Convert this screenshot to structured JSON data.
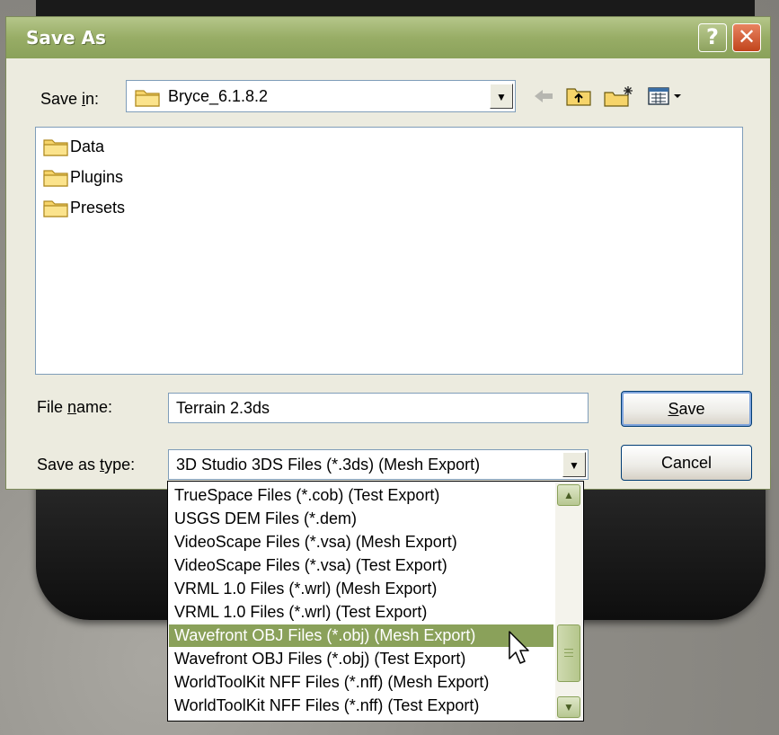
{
  "dialog": {
    "title": "Save As",
    "help_glyph": "?",
    "close_glyph": "✕"
  },
  "save_in": {
    "label_prefix": "Save ",
    "label_accel": "i",
    "label_suffix": "n:",
    "folder": "Bryce_6.1.8.2",
    "folder_icon": "folder-icon"
  },
  "toolbar": {
    "icons": [
      "back-icon",
      "up-folder-icon",
      "new-folder-icon",
      "view-menu-icon"
    ]
  },
  "files": [
    {
      "name": "Data",
      "icon": "folder-icon"
    },
    {
      "name": "Plugins",
      "icon": "folder-icon"
    },
    {
      "name": "Presets",
      "icon": "folder-icon"
    }
  ],
  "filename": {
    "label_prefix": "File ",
    "label_accel": "n",
    "label_suffix": "ame:",
    "value": "Terrain 2.3ds"
  },
  "save_type": {
    "label_prefix": "Save as ",
    "label_accel": "t",
    "label_suffix": "ype:",
    "value": "3D Studio 3DS Files (*.3ds) (Mesh Export)"
  },
  "buttons": {
    "save_accel": "S",
    "save_rest": "ave",
    "cancel": "Cancel"
  },
  "dropdown_options": [
    "TrueSpace Files (*.cob) (Test Export)",
    "USGS DEM Files (*.dem)",
    "VideoScape Files (*.vsa) (Mesh Export)",
    "VideoScape Files (*.vsa) (Test Export)",
    "VRML 1.0 Files (*.wrl) (Mesh Export)",
    "VRML 1.0 Files (*.wrl) (Test Export)",
    "Wavefront OBJ Files (*.obj) (Mesh Export)",
    "Wavefront OBJ Files (*.obj) (Test Export)",
    "WorldToolKit NFF Files (*.nff) (Mesh Export)",
    "WorldToolKit NFF Files (*.nff) (Test Export)"
  ],
  "dropdown_selected": "Wavefront OBJ Files (*.obj) (Mesh Export)",
  "colors": {
    "titlebar": "#98ad66",
    "selection": "#8aa15a",
    "close": "#c1441c"
  }
}
